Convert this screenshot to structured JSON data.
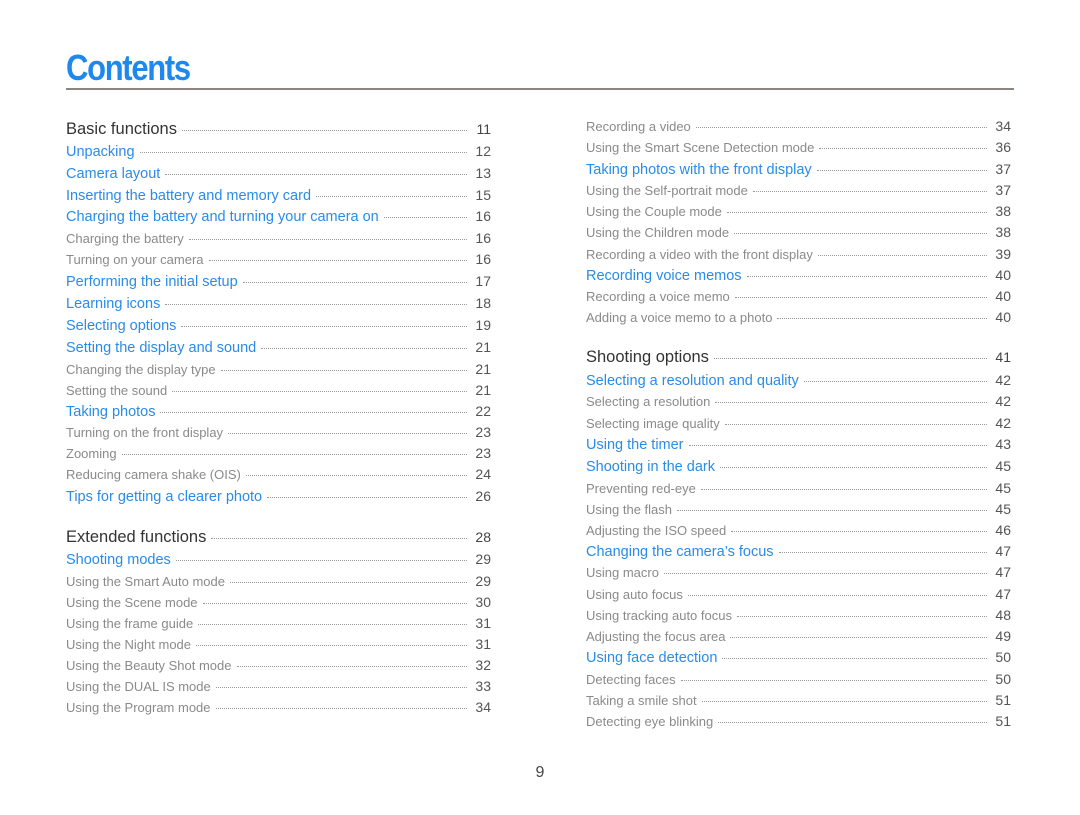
{
  "title": "Contents",
  "colors": {
    "title": "#1e88ec",
    "section_link": "#2a8be8",
    "chapter": "#333333",
    "subsection": "#8a8a8a",
    "rule": "#8e8581"
  },
  "left_column": [
    {
      "level": "h1",
      "label": "Basic functions",
      "page": "11"
    },
    {
      "level": "h2",
      "label": "Unpacking",
      "page": "12"
    },
    {
      "level": "h2",
      "label": "Camera layout",
      "page": "13"
    },
    {
      "level": "h2",
      "label": "Inserting the battery and memory card",
      "page": "15"
    },
    {
      "level": "h2",
      "label": "Charging the battery and turning your camera on",
      "page": "16"
    },
    {
      "level": "h3",
      "label": "Charging the battery",
      "page": "16"
    },
    {
      "level": "h3",
      "label": "Turning on your camera",
      "page": "16"
    },
    {
      "level": "h2",
      "label": "Performing the initial setup",
      "page": "17"
    },
    {
      "level": "h2",
      "label": "Learning icons",
      "page": "18"
    },
    {
      "level": "h2",
      "label": "Selecting options",
      "page": "19"
    },
    {
      "level": "h2",
      "label": "Setting the display and sound",
      "page": "21"
    },
    {
      "level": "h3",
      "label": "Changing the display type",
      "page": "21"
    },
    {
      "level": "h3",
      "label": "Setting the sound",
      "page": "21"
    },
    {
      "level": "h2",
      "label": "Taking photos",
      "page": "22"
    },
    {
      "level": "h3",
      "label": "Turning on the front display",
      "page": "23"
    },
    {
      "level": "h3",
      "label": "Zooming",
      "page": "23"
    },
    {
      "level": "h3",
      "label": "Reducing camera shake (OIS)",
      "page": "24"
    },
    {
      "level": "h2",
      "label": "Tips for getting a clearer photo",
      "page": "26"
    },
    {
      "level": "h1",
      "label": "Extended functions",
      "page": "28"
    },
    {
      "level": "h2",
      "label": "Shooting modes",
      "page": "29"
    },
    {
      "level": "h3",
      "label": "Using the Smart Auto mode",
      "page": "29"
    },
    {
      "level": "h3",
      "label": "Using the Scene mode",
      "page": "30"
    },
    {
      "level": "h3",
      "label": "Using the frame guide",
      "page": "31"
    },
    {
      "level": "h3",
      "label": "Using the Night mode",
      "page": "31"
    },
    {
      "level": "h3",
      "label": "Using the Beauty Shot mode",
      "page": "32"
    },
    {
      "level": "h3",
      "label": "Using the DUAL IS mode",
      "page": "33"
    },
    {
      "level": "h3",
      "label": "Using the Program mode",
      "page": "34"
    }
  ],
  "right_column": [
    {
      "level": "h3",
      "label": "Recording a video",
      "page": "34"
    },
    {
      "level": "h3",
      "label": "Using the Smart Scene Detection mode",
      "page": "36"
    },
    {
      "level": "h2",
      "label": "Taking photos with the front display",
      "page": "37"
    },
    {
      "level": "h3",
      "label": "Using the Self-portrait mode",
      "page": "37"
    },
    {
      "level": "h3",
      "label": "Using the Couple mode",
      "page": "38"
    },
    {
      "level": "h3",
      "label": "Using the Children mode",
      "page": "38"
    },
    {
      "level": "h3",
      "label": "Recording a video with the front display",
      "page": "39"
    },
    {
      "level": "h2",
      "label": "Recording voice memos",
      "page": "40"
    },
    {
      "level": "h3",
      "label": "Recording a voice memo",
      "page": "40"
    },
    {
      "level": "h3",
      "label": "Adding a voice memo to a photo",
      "page": "40"
    },
    {
      "level": "h1",
      "label": "Shooting options",
      "page": "41"
    },
    {
      "level": "h2",
      "label": "Selecting a resolution and quality",
      "page": "42"
    },
    {
      "level": "h3",
      "label": "Selecting a resolution",
      "page": "42"
    },
    {
      "level": "h3",
      "label": "Selecting image quality",
      "page": "42"
    },
    {
      "level": "h2",
      "label": "Using the timer",
      "page": "43"
    },
    {
      "level": "h2",
      "label": "Shooting in the dark",
      "page": "45"
    },
    {
      "level": "h3",
      "label": "Preventing red-eye",
      "page": "45"
    },
    {
      "level": "h3",
      "label": "Using the flash",
      "page": "45"
    },
    {
      "level": "h3",
      "label": "Adjusting the ISO speed",
      "page": "46"
    },
    {
      "level": "h2",
      "label": "Changing the camera’s focus",
      "page": "47"
    },
    {
      "level": "h3",
      "label": "Using macro",
      "page": "47"
    },
    {
      "level": "h3",
      "label": "Using auto focus",
      "page": "47"
    },
    {
      "level": "h3",
      "label": "Using tracking auto focus",
      "page": "48"
    },
    {
      "level": "h3",
      "label": "Adjusting the focus area",
      "page": "49"
    },
    {
      "level": "h2",
      "label": "Using face detection",
      "page": "50"
    },
    {
      "level": "h3",
      "label": "Detecting faces",
      "page": "50"
    },
    {
      "level": "h3",
      "label": "Taking a smile shot",
      "page": "51"
    },
    {
      "level": "h3",
      "label": "Detecting eye blinking",
      "page": "51"
    }
  ],
  "page_number": "9"
}
